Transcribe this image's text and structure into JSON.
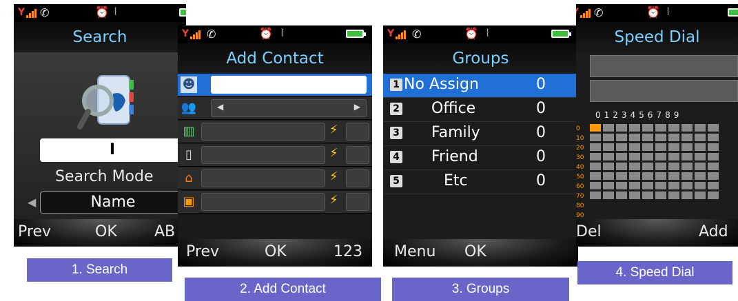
{
  "colors": {
    "title": "#7ad0ff",
    "caption_bg": "#6a66c9",
    "selected_row": "#1f6fd6",
    "accent_orange": "#ff9900"
  },
  "screens": {
    "search": {
      "title": "Search",
      "input_value": "I",
      "mode_label": "Search Mode",
      "mode_value": "Name",
      "softkeys": {
        "left": "Prev",
        "center": "OK",
        "right": "AB"
      },
      "caption": "1. Search"
    },
    "add_contact": {
      "title": "Add Contact",
      "softkeys": {
        "left": "Prev",
        "center": "OK",
        "right": "123"
      },
      "caption": "2. Add Contact"
    },
    "groups": {
      "title": "Groups",
      "rows": [
        {
          "num": "1",
          "name": "No Assign",
          "count": "0"
        },
        {
          "num": "2",
          "name": "Office",
          "count": "0"
        },
        {
          "num": "3",
          "name": "Family",
          "count": "0"
        },
        {
          "num": "4",
          "name": "Friend",
          "count": "0"
        },
        {
          "num": "5",
          "name": "Etc",
          "count": "0"
        }
      ],
      "softkeys": {
        "left": "Menu",
        "center": "OK"
      },
      "caption": "3. Groups"
    },
    "speed_dial": {
      "title": "Speed Dial",
      "digits": "0123456789",
      "row_labels": [
        "0",
        "10",
        "20",
        "30",
        "40",
        "50",
        "60",
        "70",
        "80",
        "90"
      ],
      "softkeys": {
        "left": "Del",
        "right": "Add"
      },
      "caption": "4. Speed Dial"
    }
  }
}
